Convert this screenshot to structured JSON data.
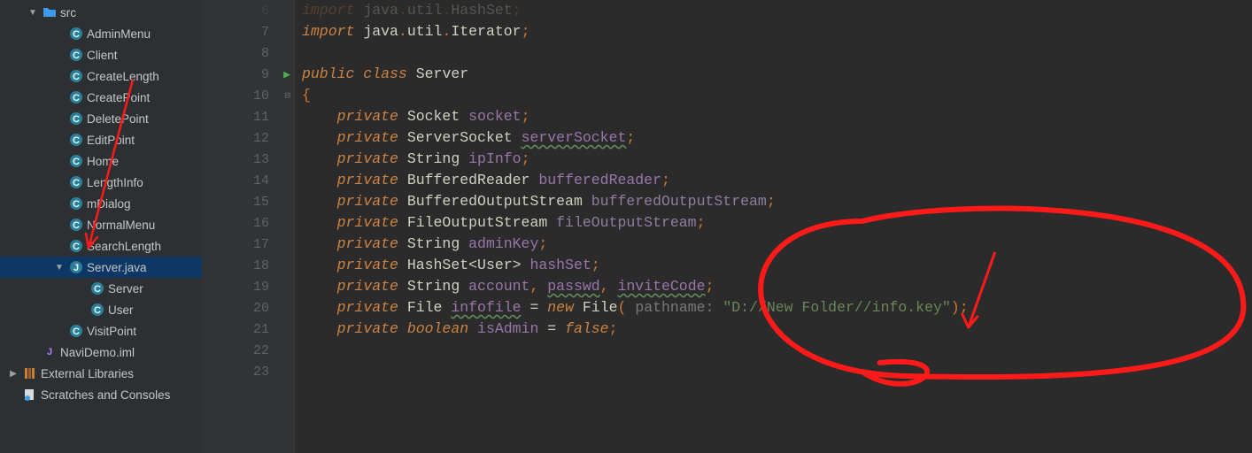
{
  "sidebar": {
    "root_folder": "src",
    "items": [
      {
        "label": "AdminMenu",
        "type": "class"
      },
      {
        "label": "Client",
        "type": "class"
      },
      {
        "label": "CreateLength",
        "type": "class"
      },
      {
        "label": "CreatePoint",
        "type": "class"
      },
      {
        "label": "DeletePoint",
        "type": "class"
      },
      {
        "label": "EditPoint",
        "type": "class"
      },
      {
        "label": "Home",
        "type": "class"
      },
      {
        "label": "LengthInfo",
        "type": "class"
      },
      {
        "label": "mDialog",
        "type": "class"
      },
      {
        "label": "NormalMenu",
        "type": "class"
      },
      {
        "label": "SearchLength",
        "type": "class"
      },
      {
        "label": "Server.java",
        "type": "java",
        "selected": true,
        "children": [
          {
            "label": "Server",
            "type": "class"
          },
          {
            "label": "User",
            "type": "class"
          }
        ]
      },
      {
        "label": "VisitPoint",
        "type": "class"
      }
    ],
    "iml_file": "NaviDemo.iml",
    "ext_lib": "External Libraries",
    "scratches": "Scratches and Consoles"
  },
  "editor": {
    "line_start": 6,
    "lines": [
      {
        "n": 6,
        "tokens": [
          [
            "kw",
            "import "
          ],
          [
            "cls",
            "java"
          ],
          [
            "pn",
            "."
          ],
          [
            "cls",
            "util"
          ],
          [
            "pn",
            "."
          ],
          [
            "cls",
            "HashSet"
          ],
          [
            "pn",
            ";"
          ]
        ],
        "fade": true
      },
      {
        "n": 7,
        "tokens": [
          [
            "kw",
            "import "
          ],
          [
            "cls",
            "java"
          ],
          [
            "pn",
            "."
          ],
          [
            "cls",
            "util"
          ],
          [
            "pn",
            "."
          ],
          [
            "cls",
            "Iterator"
          ],
          [
            "pn",
            ";"
          ]
        ]
      },
      {
        "n": 8,
        "tokens": []
      },
      {
        "n": 9,
        "tokens": [
          [
            "kw",
            "public class "
          ],
          [
            "cls",
            "Server"
          ]
        ],
        "run": true
      },
      {
        "n": 10,
        "tokens": [
          [
            "pn",
            "{"
          ]
        ],
        "fold": "-"
      },
      {
        "n": 11,
        "tokens": [
          [
            "",
            "    "
          ],
          [
            "kw",
            "private "
          ],
          [
            "cls",
            "Socket "
          ],
          [
            "field",
            "socket"
          ],
          [
            "pn",
            ";"
          ]
        ]
      },
      {
        "n": 12,
        "tokens": [
          [
            "",
            "    "
          ],
          [
            "kw",
            "private "
          ],
          [
            "cls",
            "ServerSocket "
          ],
          [
            "field underline-green",
            "serverSocket"
          ],
          [
            "pn",
            ";"
          ]
        ]
      },
      {
        "n": 13,
        "tokens": [
          [
            "",
            "    "
          ],
          [
            "kw",
            "private "
          ],
          [
            "cls",
            "String "
          ],
          [
            "field",
            "ipInfo"
          ],
          [
            "pn",
            ";"
          ]
        ]
      },
      {
        "n": 14,
        "tokens": [
          [
            "",
            "    "
          ],
          [
            "kw",
            "private "
          ],
          [
            "cls",
            "BufferedReader "
          ],
          [
            "field",
            "bufferedReader"
          ],
          [
            "pn",
            ";"
          ]
        ]
      },
      {
        "n": 15,
        "tokens": [
          [
            "",
            "    "
          ],
          [
            "kw",
            "private "
          ],
          [
            "cls",
            "BufferedOutputStream "
          ],
          [
            "var",
            "bufferedOutputStream"
          ],
          [
            "pn",
            ";"
          ]
        ]
      },
      {
        "n": 16,
        "tokens": [
          [
            "",
            "    "
          ],
          [
            "kw",
            "private "
          ],
          [
            "cls",
            "FileOutputStream "
          ],
          [
            "var",
            "fileOutputStream"
          ],
          [
            "pn",
            ";"
          ]
        ]
      },
      {
        "n": 17,
        "tokens": [
          [
            "",
            "    "
          ],
          [
            "kw",
            "private "
          ],
          [
            "cls",
            "String "
          ],
          [
            "field",
            "adminKey"
          ],
          [
            "pn",
            ";"
          ]
        ]
      },
      {
        "n": 18,
        "tokens": [
          [
            "",
            "    "
          ],
          [
            "kw",
            "private "
          ],
          [
            "cls",
            "HashSet"
          ],
          [
            "lt",
            "<"
          ],
          [
            "cls",
            "User"
          ],
          [
            "lt",
            "> "
          ],
          [
            "field",
            "hashSet"
          ],
          [
            "pn",
            ";"
          ]
        ]
      },
      {
        "n": 19,
        "tokens": [
          [
            "",
            "    "
          ],
          [
            "kw",
            "private "
          ],
          [
            "cls",
            "String "
          ],
          [
            "field",
            "account"
          ],
          [
            "pn",
            ", "
          ],
          [
            "field underline-green",
            "passwd"
          ],
          [
            "pn",
            ", "
          ],
          [
            "field underline-green",
            "inviteCode"
          ],
          [
            "pn",
            ";"
          ]
        ]
      },
      {
        "n": 20,
        "tokens": [
          [
            "",
            "    "
          ],
          [
            "kw",
            "private "
          ],
          [
            "cls",
            "File "
          ],
          [
            "field underline-green",
            "infofile"
          ],
          [
            "cls",
            " = "
          ],
          [
            "kw",
            "new "
          ],
          [
            "cls",
            "File"
          ],
          [
            "pn",
            "( "
          ],
          [
            "param",
            "pathname: "
          ],
          [
            "str",
            "\"D://New Folder//info.key\""
          ],
          [
            "pn",
            ");"
          ]
        ]
      },
      {
        "n": 21,
        "tokens": [
          [
            "",
            "    "
          ],
          [
            "kw",
            "private boolean "
          ],
          [
            "field",
            "isAdmin"
          ],
          [
            "cls",
            " = "
          ],
          [
            "kw",
            "false"
          ],
          [
            "pn",
            ";"
          ]
        ]
      },
      {
        "n": 22,
        "tokens": []
      },
      {
        "n": 23,
        "tokens": []
      }
    ]
  }
}
